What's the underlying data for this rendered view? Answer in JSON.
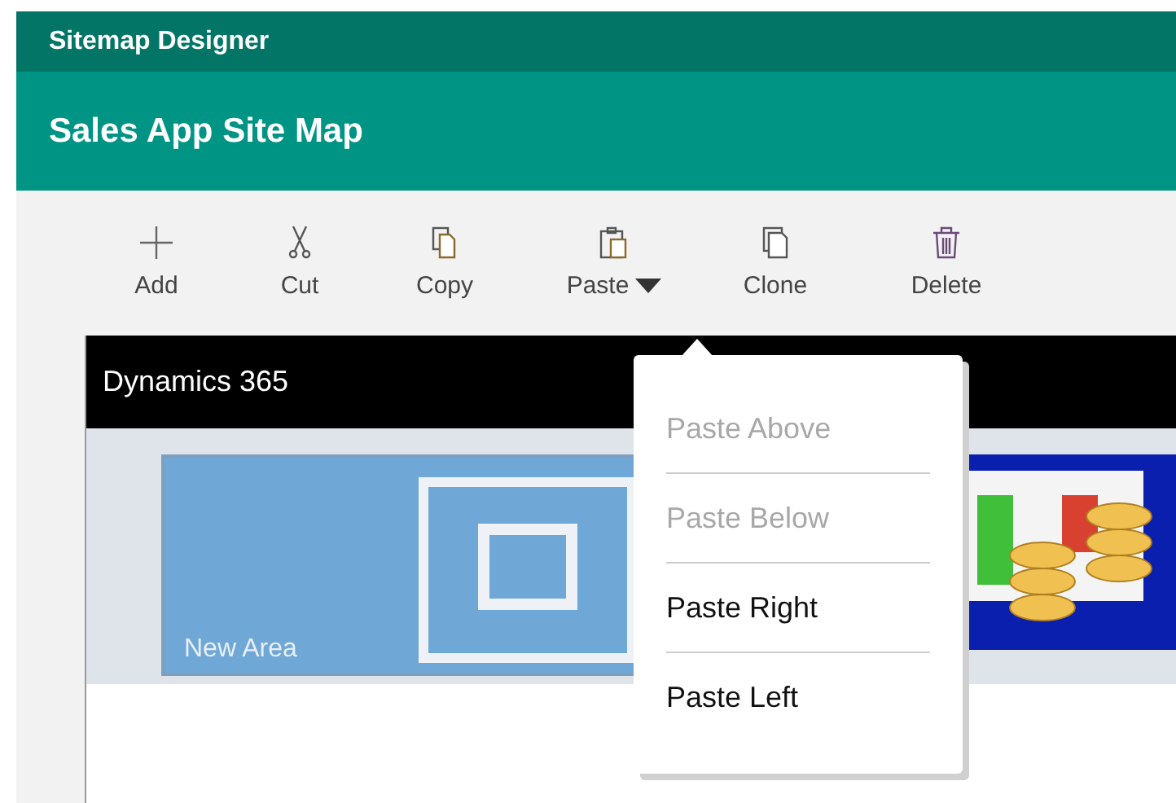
{
  "window": {
    "title": "Sitemap Designer"
  },
  "header": {
    "title": "Sales App Site Map"
  },
  "toolbar": [
    {
      "kind": "add",
      "label": "Add"
    },
    {
      "kind": "cut",
      "label": "Cut"
    },
    {
      "kind": "copy",
      "label": "Copy"
    },
    {
      "kind": "paste",
      "label": "Paste",
      "dropdown": true
    },
    {
      "kind": "clone",
      "label": "Clone"
    },
    {
      "kind": "delete",
      "label": "Delete"
    }
  ],
  "canvas": {
    "title": "Dynamics 365",
    "tiles": [
      {
        "kind": "area",
        "label": "New Area",
        "selected": true
      },
      {
        "kind": "image"
      }
    ]
  },
  "paste_menu": [
    {
      "label": "Paste Above",
      "disabled": true
    },
    {
      "label": "Paste Below",
      "disabled": true
    },
    {
      "label": "Paste Right",
      "disabled": false
    },
    {
      "label": "Paste Left",
      "disabled": false
    }
  ]
}
